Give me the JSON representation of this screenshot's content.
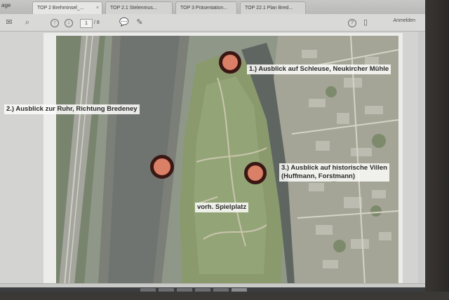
{
  "tabs": {
    "home": "age",
    "items": [
      {
        "label": "TOP 2 Brehminsel_..."
      },
      {
        "label": "TOP 2.1 Stelenmus..."
      },
      {
        "label": "TOP 3 Präsentation..."
      },
      {
        "label": "TOP 22.1 Plan Bred..."
      }
    ]
  },
  "toolbar": {
    "page_current": "1",
    "page_total": "/ 8",
    "signin_label": "Anmelden"
  },
  "map": {
    "callouts": [
      {
        "label": "1.) Ausblick auf Schleuse, Neukircher Mühle"
      },
      {
        "label": "2.) Ausblick zur Ruhr, Richtung Bredeney"
      },
      {
        "label": "3.) Ausblick auf historische Villen\n(Huffmann, Forstmann)"
      },
      {
        "label": "vorh. Spielplatz"
      }
    ],
    "marker_color": "#d98066",
    "marker_ring_color": "#3b1714"
  }
}
